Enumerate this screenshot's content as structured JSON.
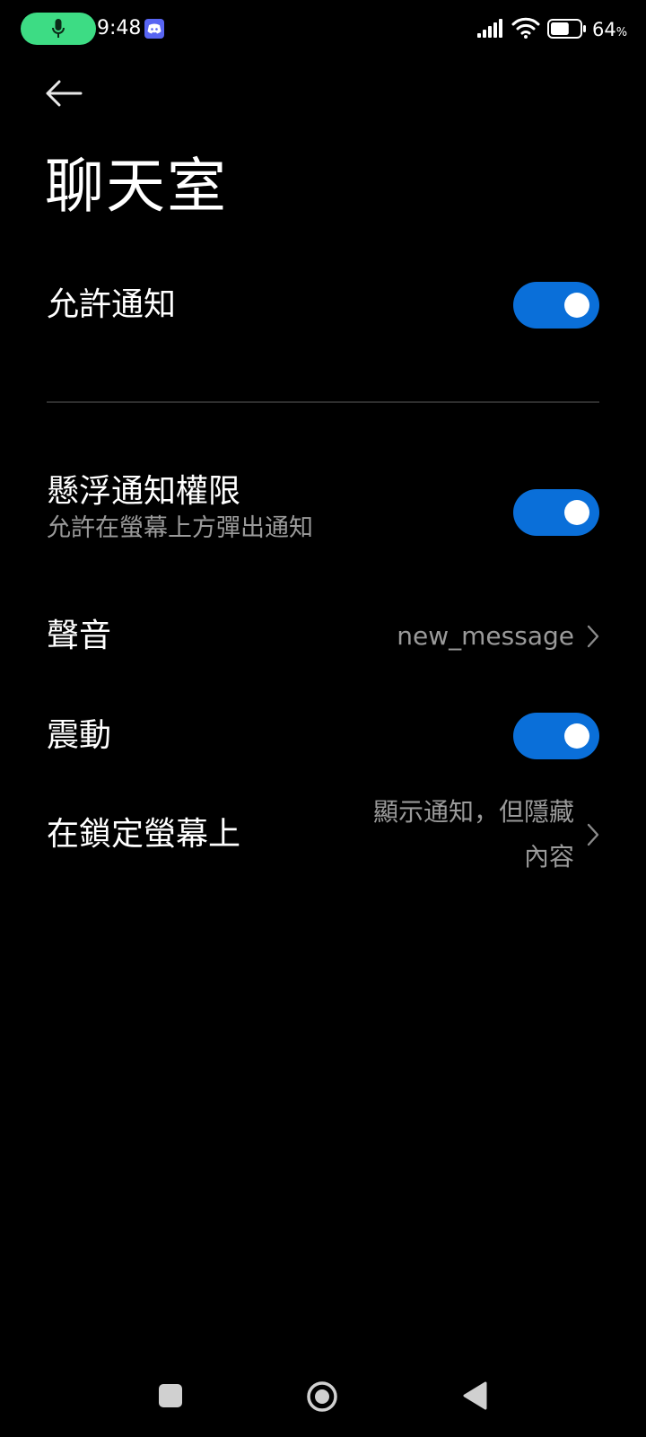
{
  "status_bar": {
    "time": "9:48",
    "battery_percent": "64",
    "battery_unit": "%",
    "battery_level": 0.64,
    "icons": [
      "mic-icon",
      "discord-icon",
      "signal-icon",
      "wifi-icon",
      "battery-icon"
    ],
    "mic_pill_color": "#3ddc84"
  },
  "header": {
    "title": "聊天室",
    "back_icon": "arrow-left-icon"
  },
  "settings": {
    "allow_notifications": {
      "label": "允許通知",
      "enabled": true
    },
    "floating_notifications": {
      "label": "懸浮通知權限",
      "subtitle": "允許在螢幕上方彈出通知",
      "enabled": true
    },
    "sound": {
      "label": "聲音",
      "value": "new_message"
    },
    "vibration": {
      "label": "震動",
      "enabled": true
    },
    "lock_screen": {
      "label": "在鎖定螢幕上",
      "value_line1": "顯示通知，但隱藏",
      "value_line2": "內容"
    }
  },
  "colors": {
    "background": "#000000",
    "toggle_on": "#0a6fd9",
    "secondary_text": "#9a9a9a",
    "divider": "#2e2e2e"
  },
  "nav_bar": {
    "icons": [
      "square-recents-icon",
      "circle-home-icon",
      "triangle-back-icon"
    ]
  }
}
